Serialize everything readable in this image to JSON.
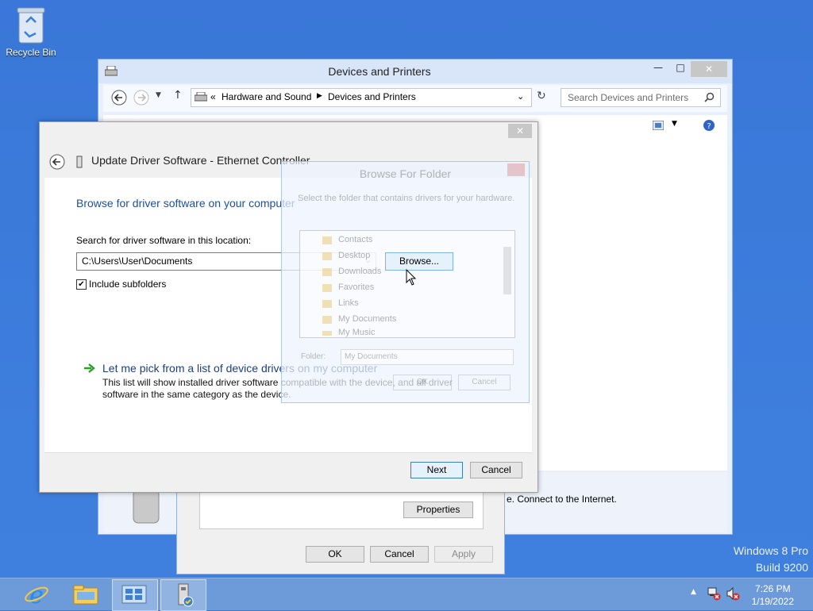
{
  "desktop": {
    "recycle_bin_label": "Recycle Bin",
    "os_name": "Windows 8 Pro",
    "build": "Build 9200"
  },
  "devices_window": {
    "title": "Devices and Printers",
    "breadcrumb_sep": "«",
    "breadcrumb": [
      "Hardware and Sound",
      "Devices and Printers"
    ],
    "search_placeholder": "Search Devices and Printers",
    "details_text": "e. Connect to the Internet."
  },
  "properties_dialog": {
    "properties_button": "Properties",
    "ok_label": "OK",
    "cancel_label": "Cancel",
    "apply_label": "Apply"
  },
  "wizard": {
    "title": "Update Driver Software - Ethernet Controller",
    "heading": "Browse for driver software on your computer",
    "search_label": "Search for driver software in this location:",
    "path_value": "C:\\Users\\User\\Documents",
    "browse_label": "Browse...",
    "include_subfolders_label": "Include subfolders",
    "include_subfolders_checked": true,
    "pick_heading": "Let me pick from a list of device drivers on my computer",
    "pick_description": "This list will show installed driver software compatible with the device, and all driver software in the same category as the device.",
    "next_label": "Next",
    "cancel_label": "Cancel"
  },
  "browse_folder": {
    "title": "Browse For Folder",
    "instruction": "Select the folder that contains drivers for your hardware.",
    "items": [
      "Contacts",
      "Desktop",
      "Downloads",
      "Favorites",
      "Links",
      "My Documents",
      "My Music"
    ],
    "folder_label": "Folder:",
    "folder_value": "My Documents",
    "ok_label": "OK",
    "cancel_label": "Cancel"
  },
  "taskbar": {
    "time": "7:26 PM",
    "date": "1/19/2022"
  },
  "colors": {
    "desktop": "#3b78d8",
    "taskbar": "#6d9ad8",
    "heading": "#1f4e9c"
  }
}
